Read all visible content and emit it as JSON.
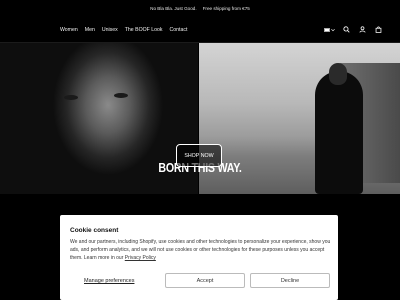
{
  "announcement": {
    "message_1": "No Bla Bla. Just Good.",
    "message_2": "Free shipping from €75"
  },
  "nav": {
    "items": [
      "Women",
      "Men",
      "Unisex",
      "The BOOF Look",
      "Contact"
    ]
  },
  "icons": {
    "locale": "flag-icon",
    "search": "search-icon",
    "account": "account-icon",
    "cart": "cart-icon"
  },
  "hero": {
    "title": "BORN THIS WAY.",
    "cta_label": "SHOP NOW"
  },
  "cookie_consent": {
    "title": "Cookie consent",
    "body_text": "We and our partners, including Shopify, use cookies and other technologies to personalize your experience, show you ads, and perform analytics, and we will not use cookies or other technologies for these purposes unless you accept them. Learn more in our",
    "policy_link": "Privacy Policy",
    "manage_label": "Manage preferences",
    "accept_label": "Accept",
    "decline_label": "Decline"
  }
}
